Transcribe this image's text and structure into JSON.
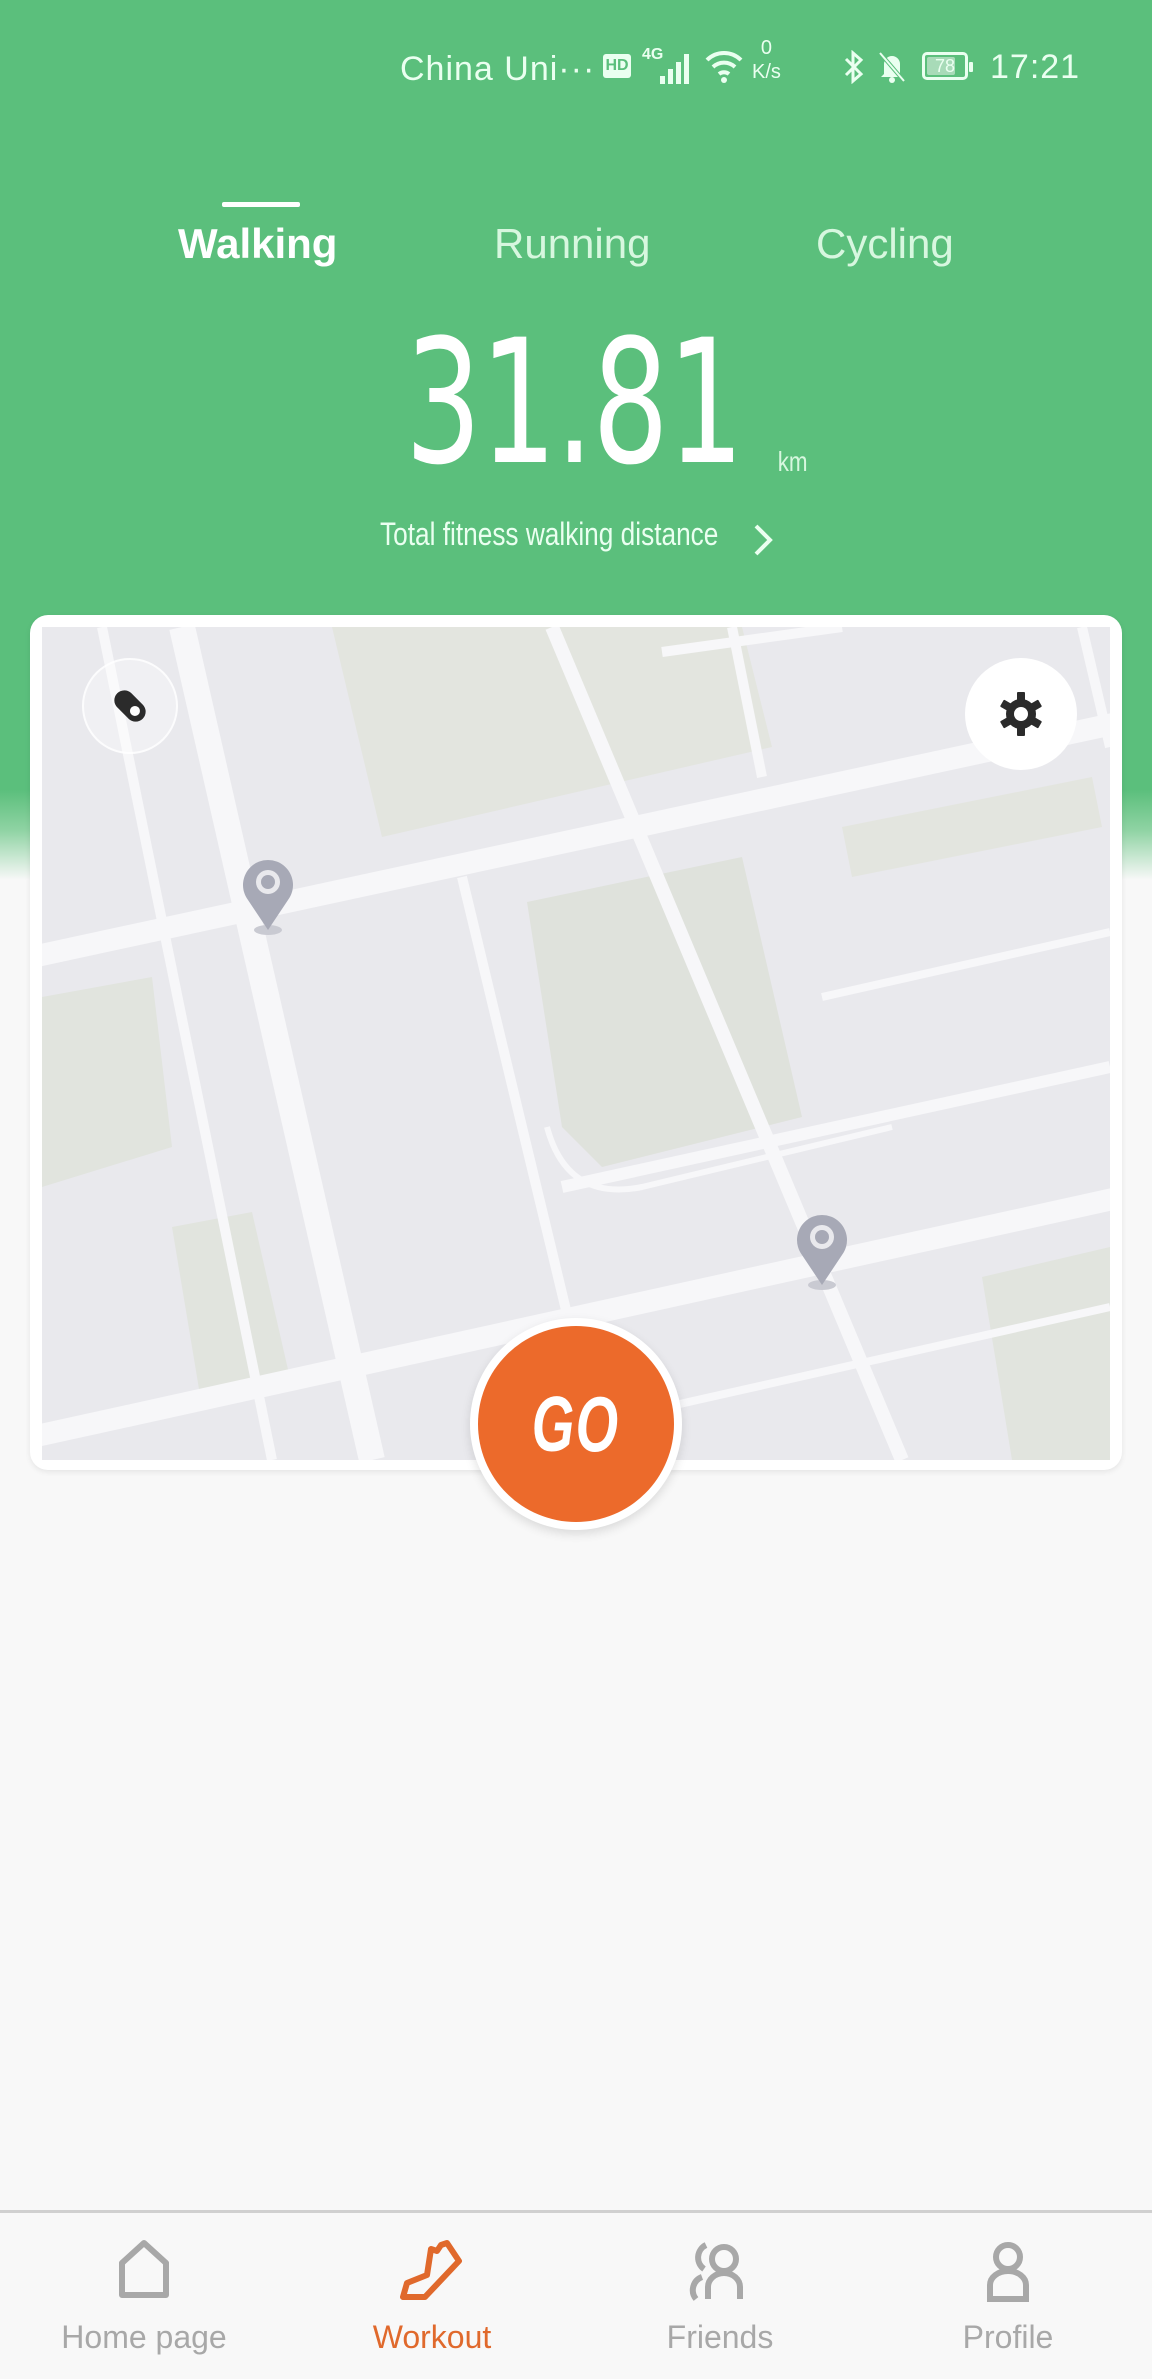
{
  "status_bar": {
    "carrier": "China Uni···",
    "hd_badge": "HD",
    "network": "4G",
    "speed_value": "0",
    "speed_unit": "K/s",
    "battery": "78",
    "time": "17:21"
  },
  "tabs": [
    {
      "label": "Walking",
      "active": true
    },
    {
      "label": "Running",
      "active": false
    },
    {
      "label": "Cycling",
      "active": false
    }
  ],
  "distance": {
    "value": "31.81",
    "unit": "km",
    "label": "Total fitness walking distance"
  },
  "map": {
    "lock_icon": "lock-icon",
    "settings_icon": "gear-icon",
    "pins": [
      "location-pin-icon",
      "location-pin-icon"
    ]
  },
  "go_button": {
    "label": "GO"
  },
  "colors": {
    "brand_green": "#5bbf7c",
    "accent_orange": "#ec6a2b",
    "inactive_gray": "#a8a8a8"
  },
  "bottom_nav": [
    {
      "label": "Home page",
      "icon": "home-icon",
      "active": false
    },
    {
      "label": "Workout",
      "icon": "shoe-icon",
      "active": true
    },
    {
      "label": "Friends",
      "icon": "friends-icon",
      "active": false
    },
    {
      "label": "Profile",
      "icon": "profile-icon",
      "active": false
    }
  ]
}
